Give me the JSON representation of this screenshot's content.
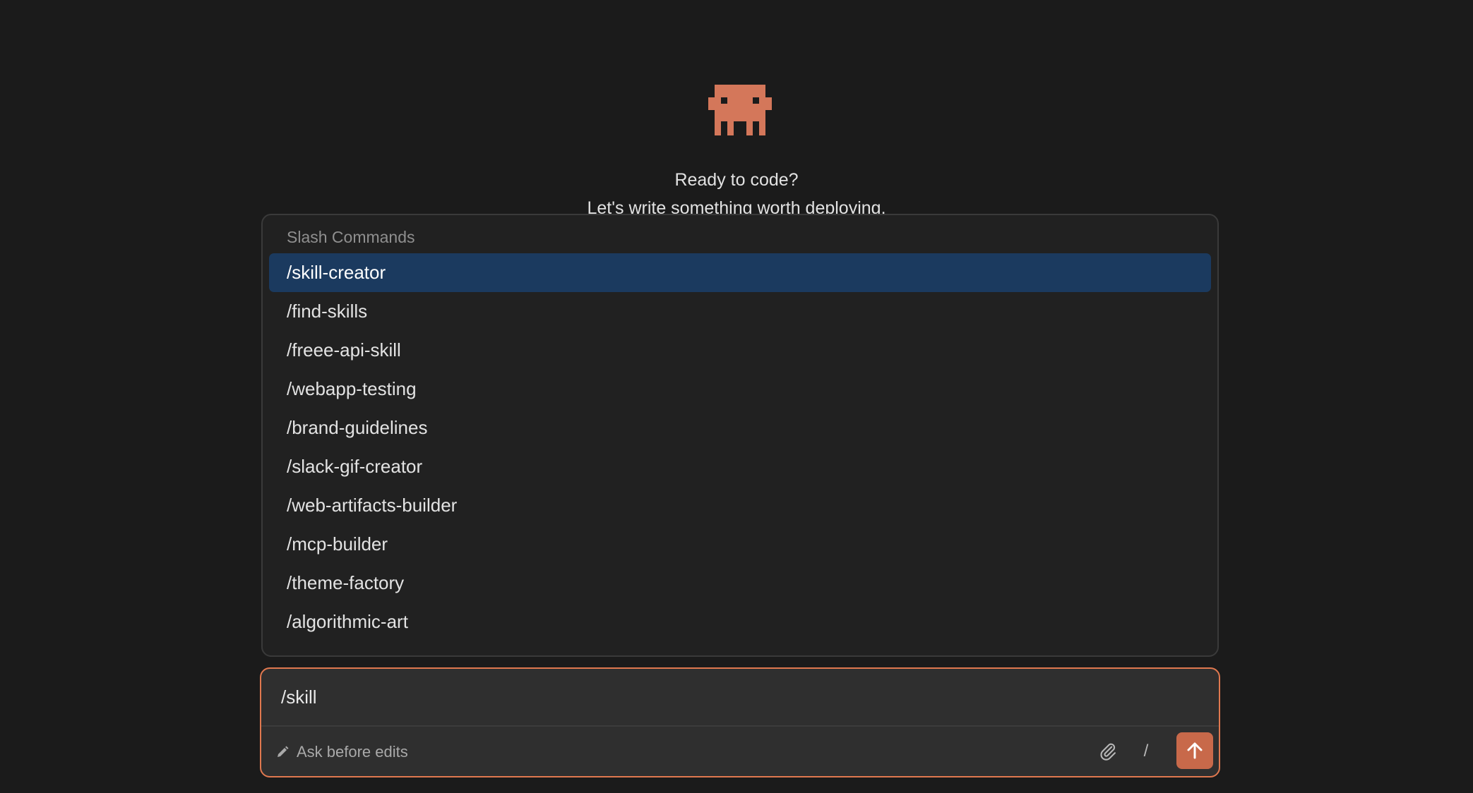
{
  "welcome": {
    "title": "Ready to code?",
    "subtitle": "Let's write something worth deploying."
  },
  "slash_menu": {
    "header": "Slash Commands",
    "items": [
      "/skill-creator",
      "/find-skills",
      "/freee-api-skill",
      "/webapp-testing",
      "/brand-guidelines",
      "/slack-gif-creator",
      "/web-artifacts-builder",
      "/mcp-builder",
      "/theme-factory",
      "/algorithmic-art"
    ],
    "selected_index": 0
  },
  "composer": {
    "value": "/skill",
    "mode_label": "Ask before edits",
    "slash_label": "/"
  },
  "icons": {
    "mascot": "pixel-creature-icon",
    "mode": "pencil-icon",
    "attach": "paperclip-icon",
    "send": "arrow-up-icon"
  },
  "colors": {
    "background": "#1b1b1b",
    "accent": "#c8694a",
    "accent_border": "#e0784f",
    "selection": "#1b3a5f",
    "mascot": "#d4775a"
  }
}
